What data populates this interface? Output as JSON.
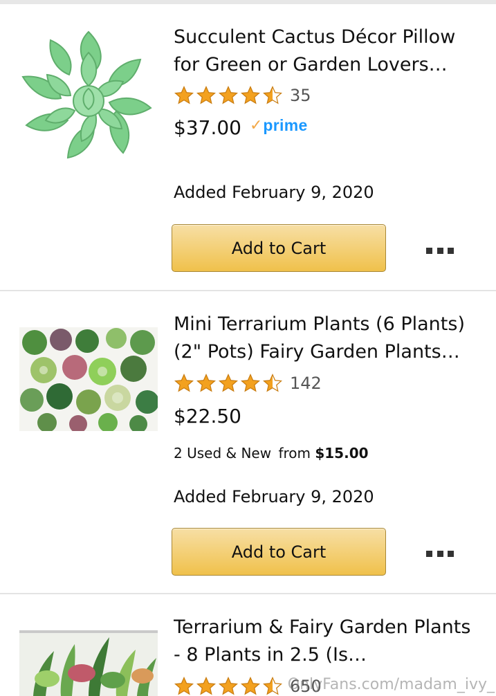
{
  "items": [
    {
      "title_line1": "Succulent Cactus Décor Pillow",
      "title_line2": "for Green or Garden Lovers…",
      "rating": 4.5,
      "review_count": "35",
      "price": "$37.00",
      "prime": true,
      "prime_label": "prime",
      "added": "Added February 9, 2020",
      "cart_label": "Add to Cart",
      "image": "succulent-pillow"
    },
    {
      "title_line1": "Mini Terrarium Plants (6 Plants)",
      "title_line2": "(2\" Pots) Fairy Garden Plants…",
      "rating": 4.5,
      "review_count": "142",
      "price": "$22.50",
      "used_new_label": "2 Used & New",
      "from_label": "from",
      "from_price": "$15.00",
      "added": "Added February 9, 2020",
      "cart_label": "Add to Cart",
      "image": "terrarium-plants"
    },
    {
      "title_line1": "Terrarium & Fairy Garden Plants",
      "title_line2": "- 8 Plants in 2.5 (Is…",
      "rating": 4.5,
      "review_count": "650",
      "image": "potted-plants"
    }
  ],
  "watermark": "OnlyFans.com/madam_ivy_",
  "colors": {
    "star": "#f3a11f",
    "prime_blue": "#1a98ff",
    "prime_check": "#f3a847",
    "button_top": "#f7dfa5",
    "button_bottom": "#f0c14b",
    "button_border": "#a88734"
  },
  "icons": {
    "star": "star-icon",
    "half_star": "half-star-icon",
    "more": "more-options-icon"
  }
}
